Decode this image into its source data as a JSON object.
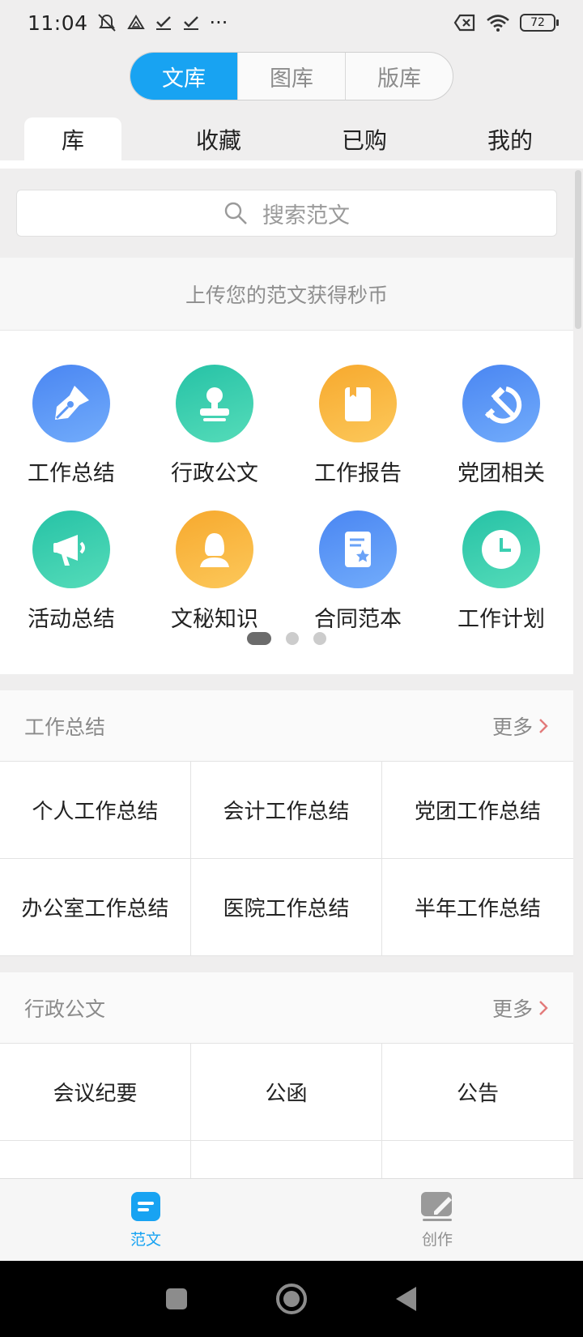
{
  "status_bar": {
    "time": "11:04",
    "more_dots": "···",
    "battery": "72",
    "icons": [
      "mute-icon",
      "drive-icon",
      "check-icon",
      "check-icon",
      "no-sim-icon",
      "wifi-icon",
      "battery-icon"
    ]
  },
  "library_tabs": [
    {
      "label": "文库",
      "active": true
    },
    {
      "label": "图库",
      "active": false
    },
    {
      "label": "版库",
      "active": false
    }
  ],
  "sub_tabs": [
    {
      "label": "库",
      "active": true
    },
    {
      "label": "收藏",
      "active": false
    },
    {
      "label": "已购",
      "active": false
    },
    {
      "label": "我的",
      "active": false
    }
  ],
  "search": {
    "placeholder": "搜索范文"
  },
  "upload_banner": "上传您的范文获得秒币",
  "categories": [
    {
      "label": "工作总结",
      "icon": "pen-nib-icon",
      "color": "#4c8ff5"
    },
    {
      "label": "行政公文",
      "icon": "stamp-icon",
      "color": "#2fc9ac"
    },
    {
      "label": "工作报告",
      "icon": "notebook-icon",
      "color": "#f7b23b"
    },
    {
      "label": "党团相关",
      "icon": "hammer-sickle-icon",
      "color": "#4c8ff5"
    },
    {
      "label": "活动总结",
      "icon": "megaphone-icon",
      "color": "#2fc9ac"
    },
    {
      "label": "文秘知识",
      "icon": "secretary-icon",
      "color": "#f7b23b"
    },
    {
      "label": "合同范本",
      "icon": "contract-icon",
      "color": "#4c8ff5"
    },
    {
      "label": "工作计划",
      "icon": "clock-icon",
      "color": "#2fc9ac"
    }
  ],
  "pager": {
    "count": 3,
    "active": 0
  },
  "sections": [
    {
      "title": "工作总结",
      "more": "更多",
      "items": [
        "个人工作总结",
        "会计工作总结",
        "党团工作总结",
        "办公室工作总结",
        "医院工作总结",
        "半年工作总结"
      ]
    },
    {
      "title": "行政公文",
      "more": "更多",
      "items": [
        "会议纪要",
        "公函",
        "公告"
      ]
    }
  ],
  "bottom_nav": [
    {
      "label": "范文",
      "icon": "document-icon",
      "active": true
    },
    {
      "label": "创作",
      "icon": "compose-icon",
      "active": false
    }
  ],
  "colors": {
    "accent": "#18a3f2",
    "more_arrow": "#e27a7a"
  }
}
